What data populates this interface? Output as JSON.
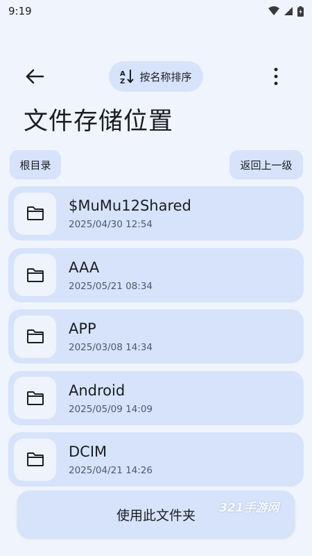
{
  "status_bar": {
    "time": "9:19"
  },
  "top_bar": {
    "sort_label": "按名称排序"
  },
  "page_title": "文件存储位置",
  "nav": {
    "root_label": "根目录",
    "up_label": "返回上一级"
  },
  "files": [
    {
      "name": "$MuMu12Shared",
      "date": "2025/04/30 12:54"
    },
    {
      "name": "AAA",
      "date": "2025/05/21 08:34"
    },
    {
      "name": "APP",
      "date": "2025/03/08 14:34"
    },
    {
      "name": "Android",
      "date": "2025/05/09 14:09"
    },
    {
      "name": "DCIM",
      "date": "2025/04/21 14:26"
    }
  ],
  "use_folder_label": "使用此文件夹",
  "watermark": "321手游网",
  "icons": {
    "back": "arrow-left-icon",
    "sort": "sort-alpha-icon",
    "menu": "more-vertical-icon",
    "folder": "folder-icon"
  },
  "colors": {
    "background": "#f0f4fd",
    "surface": "#d6e3fb",
    "icon_tile": "#eef3fc"
  }
}
